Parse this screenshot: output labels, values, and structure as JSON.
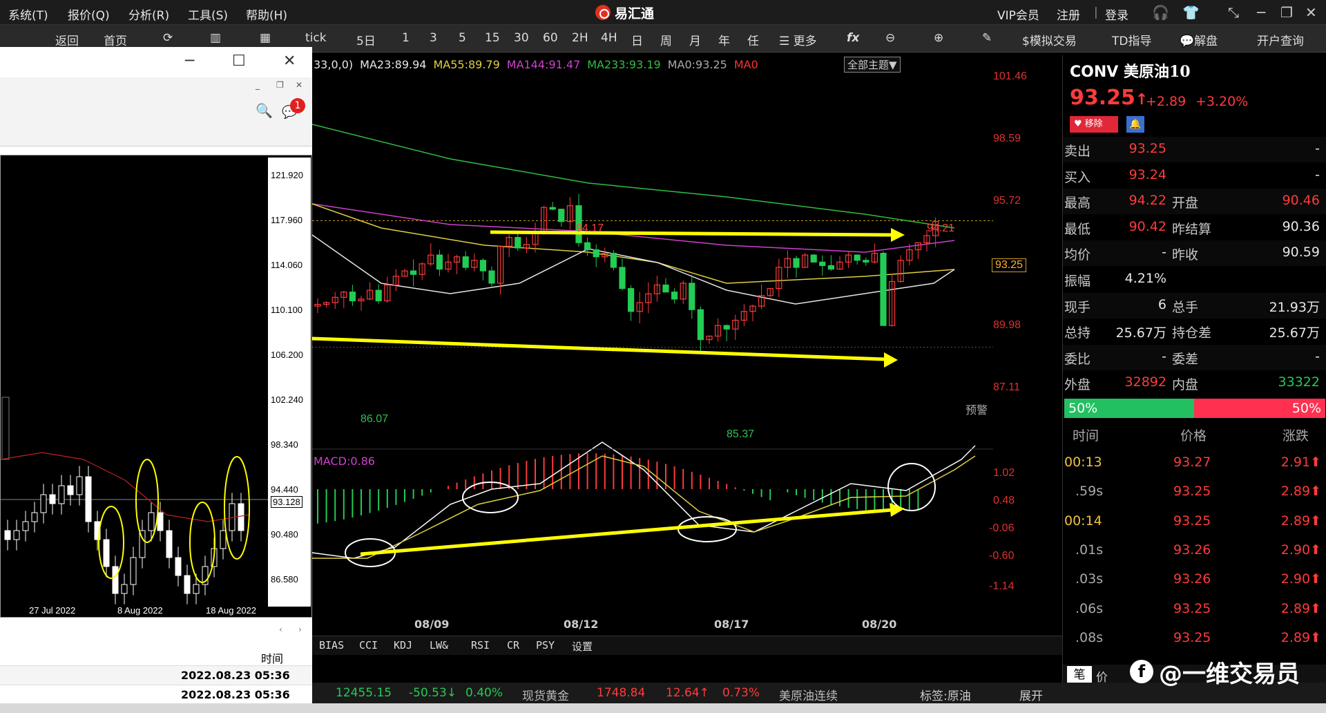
{
  "menu": {
    "items": [
      "系统(T)",
      "报价(Q)",
      "分析(R)",
      "工具(S)",
      "帮助(H)"
    ]
  },
  "app": {
    "title": "易汇通"
  },
  "topbar": {
    "vip": "VIP会员",
    "register": "注册",
    "sep": "|",
    "login": "登录"
  },
  "toolbar": {
    "back": "返回",
    "home": "首页",
    "tick": "tick",
    "periods": [
      "5日",
      "1",
      "3",
      "5",
      "15",
      "30",
      "60",
      "2H",
      "4H",
      "日",
      "周",
      "月",
      "年",
      "任"
    ],
    "more": "更多",
    "fx": "fx",
    "sim_trade": "$模拟交易",
    "td": "TD指导",
    "explain": "解盘",
    "account": "开户查询"
  },
  "mt": {
    "price_ticks": [
      "121.920",
      "117.960",
      "114.060",
      "110.100",
      "106.200",
      "102.240",
      "98.340",
      "94.440",
      "93.128",
      "90.480",
      "86.580"
    ],
    "dates": [
      "27 Jul 2022",
      "8 Aug 2022",
      "18 Aug 2022"
    ],
    "badge": "1",
    "time_header": "时间",
    "rows": [
      "2022.08.23 05:36",
      "2022.08.23 05:36"
    ]
  },
  "main": {
    "legend": [
      {
        "text": "33,0,0)",
        "color": "#e6e6e6"
      },
      {
        "text": "MA23:89.94",
        "color": "#e6e6e6"
      },
      {
        "text": "MA55:89.79",
        "color": "#e0d040"
      },
      {
        "text": "MA144:91.47",
        "color": "#d040d0"
      },
      {
        "text": "MA233:93.19",
        "color": "#30c040"
      },
      {
        "text": "MA0:93.25",
        "color": "#aaaaaa"
      },
      {
        "text": "MA0",
        "color": "#ff3030"
      }
    ],
    "theme_btn": "全部主题▼",
    "price_axis": [
      "101.46",
      "98.59",
      "95.72",
      "93.25",
      "89.98",
      "87.11"
    ],
    "high_labels": [
      "94.17",
      "94.21"
    ],
    "low_labels": [
      "86.07",
      "85.37"
    ],
    "alert": "预警",
    "macd_label": "MACD:0.86",
    "macd_axis": [
      "1.02",
      "0.48",
      "-0.06",
      "-0.60",
      "-1.14"
    ],
    "dates": [
      "08/09",
      "08/12",
      "08/17",
      "08/20"
    ],
    "indicators": [
      "BIAS",
      "CCI",
      "KDJ",
      "LW&",
      "RSI",
      "CR",
      "PSY",
      "设置"
    ],
    "tag": "标签:原油",
    "expand": "展开"
  },
  "quote": {
    "code": "CONV",
    "name": "美原油10",
    "price": "93.25",
    "change": "+2.89",
    "pct": "+3.20%",
    "remove": "移除",
    "rows": [
      {
        "l1": "卖出",
        "v1": "93.25",
        "l2": "",
        "v2": "-"
      },
      {
        "l1": "买入",
        "v1": "93.24",
        "l2": "",
        "v2": "-"
      },
      {
        "l1": "最高",
        "v1": "94.22",
        "l2": "开盘",
        "v2": "90.46"
      },
      {
        "l1": "最低",
        "v1": "90.42",
        "l2": "昨结算",
        "v2": "90.36"
      },
      {
        "l1": "均价",
        "v1": "-",
        "l2": "昨收",
        "v2": "90.59"
      },
      {
        "l1": "振幅",
        "v1": "4.21%",
        "l2": "",
        "v2": ""
      },
      {
        "l1": "现手",
        "v1": "6",
        "l2": "总手",
        "v2": "21.93万"
      },
      {
        "l1": "总持",
        "v1": "25.67万",
        "l2": "持仓差",
        "v2": "25.67万"
      },
      {
        "l1": "委比",
        "v1": "-",
        "l2": "委差",
        "v2": "-"
      },
      {
        "l1": "外盘",
        "v1": "32892",
        "l2": "内盘",
        "v2": "33322"
      }
    ],
    "bar_left": "50%",
    "bar_right": "50%",
    "ticks_header": [
      "时间",
      "价格",
      "涨跌"
    ],
    "ticks": [
      {
        "t": "00:13",
        "p": "93.27",
        "c": "2.91"
      },
      {
        "t": ".59s",
        "p": "93.25",
        "c": "2.89"
      },
      {
        "t": "00:14",
        "p": "93.25",
        "c": "2.89"
      },
      {
        "t": ".01s",
        "p": "93.26",
        "c": "2.90"
      },
      {
        "t": ".03s",
        "p": "93.26",
        "c": "2.90"
      },
      {
        "t": ".06s",
        "p": "93.25",
        "c": "2.89"
      },
      {
        "t": ".08s",
        "p": "93.25",
        "c": "2.89"
      }
    ],
    "tabs": [
      "笔",
      "价"
    ]
  },
  "status": [
    {
      "text": "12455.15",
      "color": "#22cc55"
    },
    {
      "text": "-50.53↓",
      "color": "#22cc55"
    },
    {
      "text": "0.40%",
      "color": "#22cc55"
    },
    {
      "text": "现货黄金",
      "color": "#bbbbbb"
    },
    {
      "text": "1748.84",
      "color": "#ff3b3b"
    },
    {
      "text": "12.64↑",
      "color": "#ff3b3b"
    },
    {
      "text": "0.73%",
      "color": "#ff3b3b"
    },
    {
      "text": "美原油连续",
      "color": "#bbbbbb"
    }
  ],
  "watermark": "@一维交易员"
}
